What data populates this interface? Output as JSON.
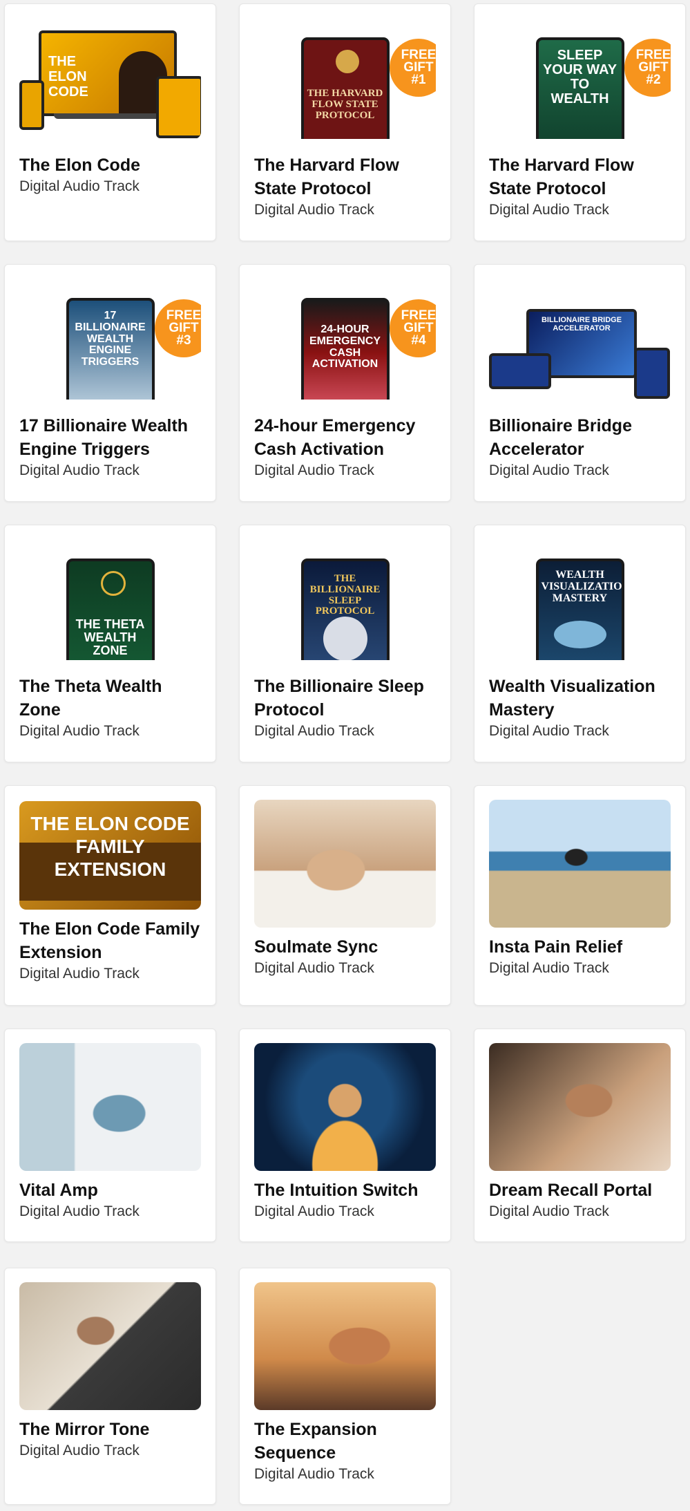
{
  "subtitle": "Digital Audio Track",
  "products": [
    {
      "title": "The Elon Code",
      "cover_text": "THE ELON CODE"
    },
    {
      "title": "The Harvard Flow State Protocol",
      "cover_text": "THE HARVARD FLOW STATE PROTOCOL",
      "badge": "FREE\nGIFT\n#1"
    },
    {
      "title": "The Harvard Flow State Protocol",
      "cover_text": "SLEEP YOUR WAY TO WEALTH",
      "badge": "FREE\nGIFT\n#2"
    },
    {
      "title": "17 Billionaire Wealth Engine Triggers",
      "cover_text": "17 BILLIONAIRE WEALTH ENGINE TRIGGERS",
      "badge": "FREE\nGIFT\n#3"
    },
    {
      "title": "24-hour Emergency Cash Activation",
      "cover_text": "24-HOUR EMERGENCY CASH ACTIVATION",
      "badge": "FREE\nGIFT\n#4"
    },
    {
      "title": "Billionaire Bridge Accelerator",
      "cover_text": "BILLIONAIRE BRIDGE ACCELERATOR"
    },
    {
      "title": "The Theta Wealth Zone",
      "cover_text": "THE THETA WEALTH ZONE"
    },
    {
      "title": "The Billionaire Sleep Protocol",
      "cover_text": "THE BILLIONAIRE SLEEP PROTOCOL"
    },
    {
      "title": "Wealth Visualization Mastery",
      "cover_text": "WEALTH VISUALIZATION MASTERY"
    },
    {
      "title": "The Elon Code Family Extension",
      "cover_text": "THE ELON CODE FAMILY EXTENSION"
    },
    {
      "title": "Soulmate Sync"
    },
    {
      "title": "Insta Pain Relief"
    },
    {
      "title": "Vital Amp"
    },
    {
      "title": "The Intuition Switch"
    },
    {
      "title": "Dream Recall Portal"
    },
    {
      "title": "The Mirror Tone"
    },
    {
      "title": "The Expansion Sequence"
    }
  ]
}
